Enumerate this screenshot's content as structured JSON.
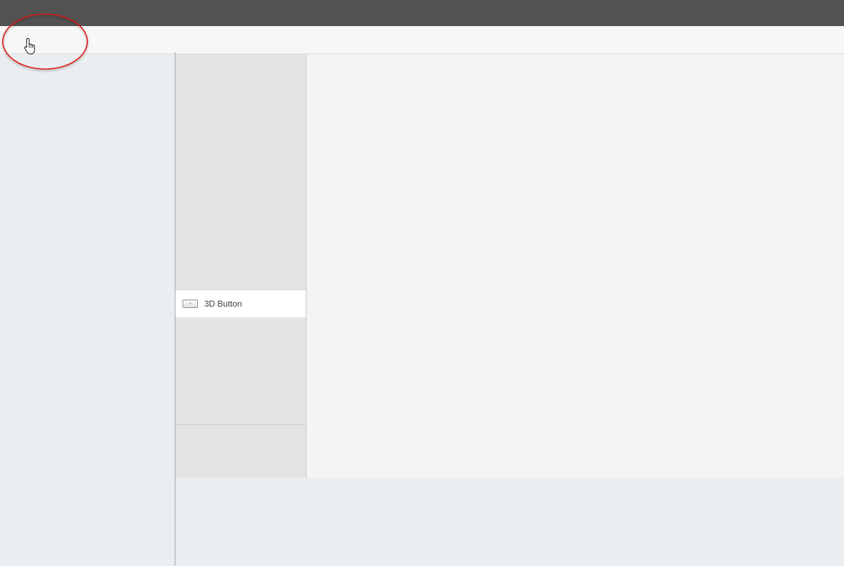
{
  "components_list": {
    "items": [
      {
        "label": "3D Button",
        "icon": "button-icon"
      }
    ]
  },
  "annotation": {
    "color": "#e01515"
  }
}
